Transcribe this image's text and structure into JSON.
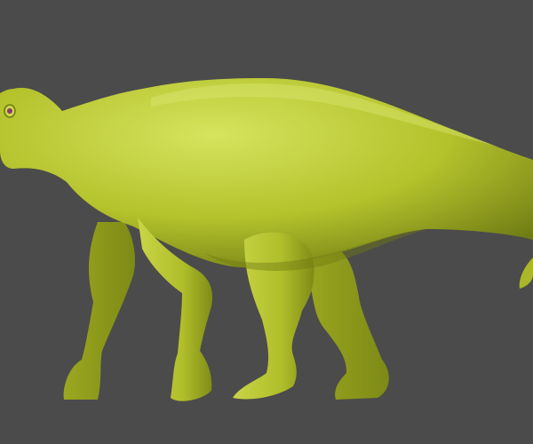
{
  "colors": {
    "background": "#4b4b4b",
    "model_base": "#b4c22c",
    "model_highlight": "#dbe86a",
    "model_shadow": "#5e6a10",
    "eye": "#8a3a6a"
  }
}
